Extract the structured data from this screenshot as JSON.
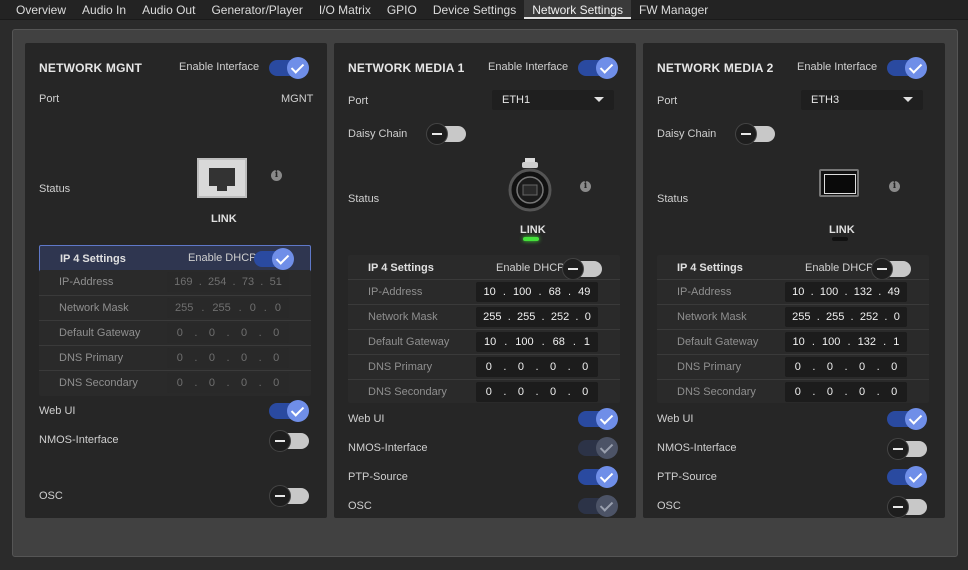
{
  "tabs": [
    {
      "label": "Overview",
      "active": false
    },
    {
      "label": "Audio In",
      "active": false
    },
    {
      "label": "Audio Out",
      "active": false
    },
    {
      "label": "Generator/Player",
      "active": false
    },
    {
      "label": "I/O Matrix",
      "active": false
    },
    {
      "label": "GPIO",
      "active": false
    },
    {
      "label": "Device Settings",
      "active": false
    },
    {
      "label": "Network Settings",
      "active": true
    },
    {
      "label": "FW Manager",
      "active": false
    }
  ],
  "labels": {
    "enable_interface": "Enable Interface",
    "port": "Port",
    "daisy_chain": "Daisy Chain",
    "status": "Status",
    "ip4_settings": "IP 4 Settings",
    "enable_dhcp": "Enable DHCP",
    "ip_address": "IP-Address",
    "network_mask": "Network Mask",
    "default_gateway": "Default Gateway",
    "dns_primary": "DNS Primary",
    "dns_secondary": "DNS Secondary",
    "web_ui": "Web UI",
    "nmos_interface": "NMOS-Interface",
    "ptp_source": "PTP-Source",
    "osc": "OSC",
    "info": "i"
  },
  "mgnt": {
    "title": "NETWORK MGNT",
    "enable_interface": true,
    "port_value": "MGNT",
    "link": "LINK",
    "dhcp": true,
    "ip_address": [
      "169",
      "254",
      "73",
      "51"
    ],
    "network_mask": [
      "255",
      "255",
      "0",
      "0"
    ],
    "default_gateway": [
      "0",
      "0",
      "0",
      "0"
    ],
    "dns_primary": [
      "0",
      "0",
      "0",
      "0"
    ],
    "dns_secondary": [
      "0",
      "0",
      "0",
      "0"
    ],
    "web_ui": true,
    "nmos": false,
    "osc": false
  },
  "media1": {
    "title": "NETWORK MEDIA 1",
    "enable_interface": true,
    "port_value": "ETH1",
    "daisy_chain": false,
    "link": "LINK",
    "link_active": true,
    "dhcp": false,
    "ip_address": [
      "10",
      "100",
      "68",
      "49"
    ],
    "network_mask": [
      "255",
      "255",
      "252",
      "0"
    ],
    "default_gateway": [
      "10",
      "100",
      "68",
      "1"
    ],
    "dns_primary": [
      "0",
      "0",
      "0",
      "0"
    ],
    "dns_secondary": [
      "0",
      "0",
      "0",
      "0"
    ],
    "web_ui": true,
    "nmos": true,
    "ptp_source": true,
    "osc": true
  },
  "media2": {
    "title": "NETWORK MEDIA 2",
    "enable_interface": true,
    "port_value": "ETH3",
    "daisy_chain": false,
    "link": "LINK",
    "link_active": false,
    "dhcp": false,
    "ip_address": [
      "10",
      "100",
      "132",
      "49"
    ],
    "network_mask": [
      "255",
      "255",
      "252",
      "0"
    ],
    "default_gateway": [
      "10",
      "100",
      "132",
      "1"
    ],
    "dns_primary": [
      "0",
      "0",
      "0",
      "0"
    ],
    "dns_secondary": [
      "0",
      "0",
      "0",
      "0"
    ],
    "web_ui": true,
    "nmos": false,
    "ptp_source": true,
    "osc": false
  },
  "colors": {
    "toggle_on": "#2a4aa0",
    "knob_on": "#6f8ee8",
    "link_led": "#44e03a",
    "selection_border": "#5f78c8"
  }
}
